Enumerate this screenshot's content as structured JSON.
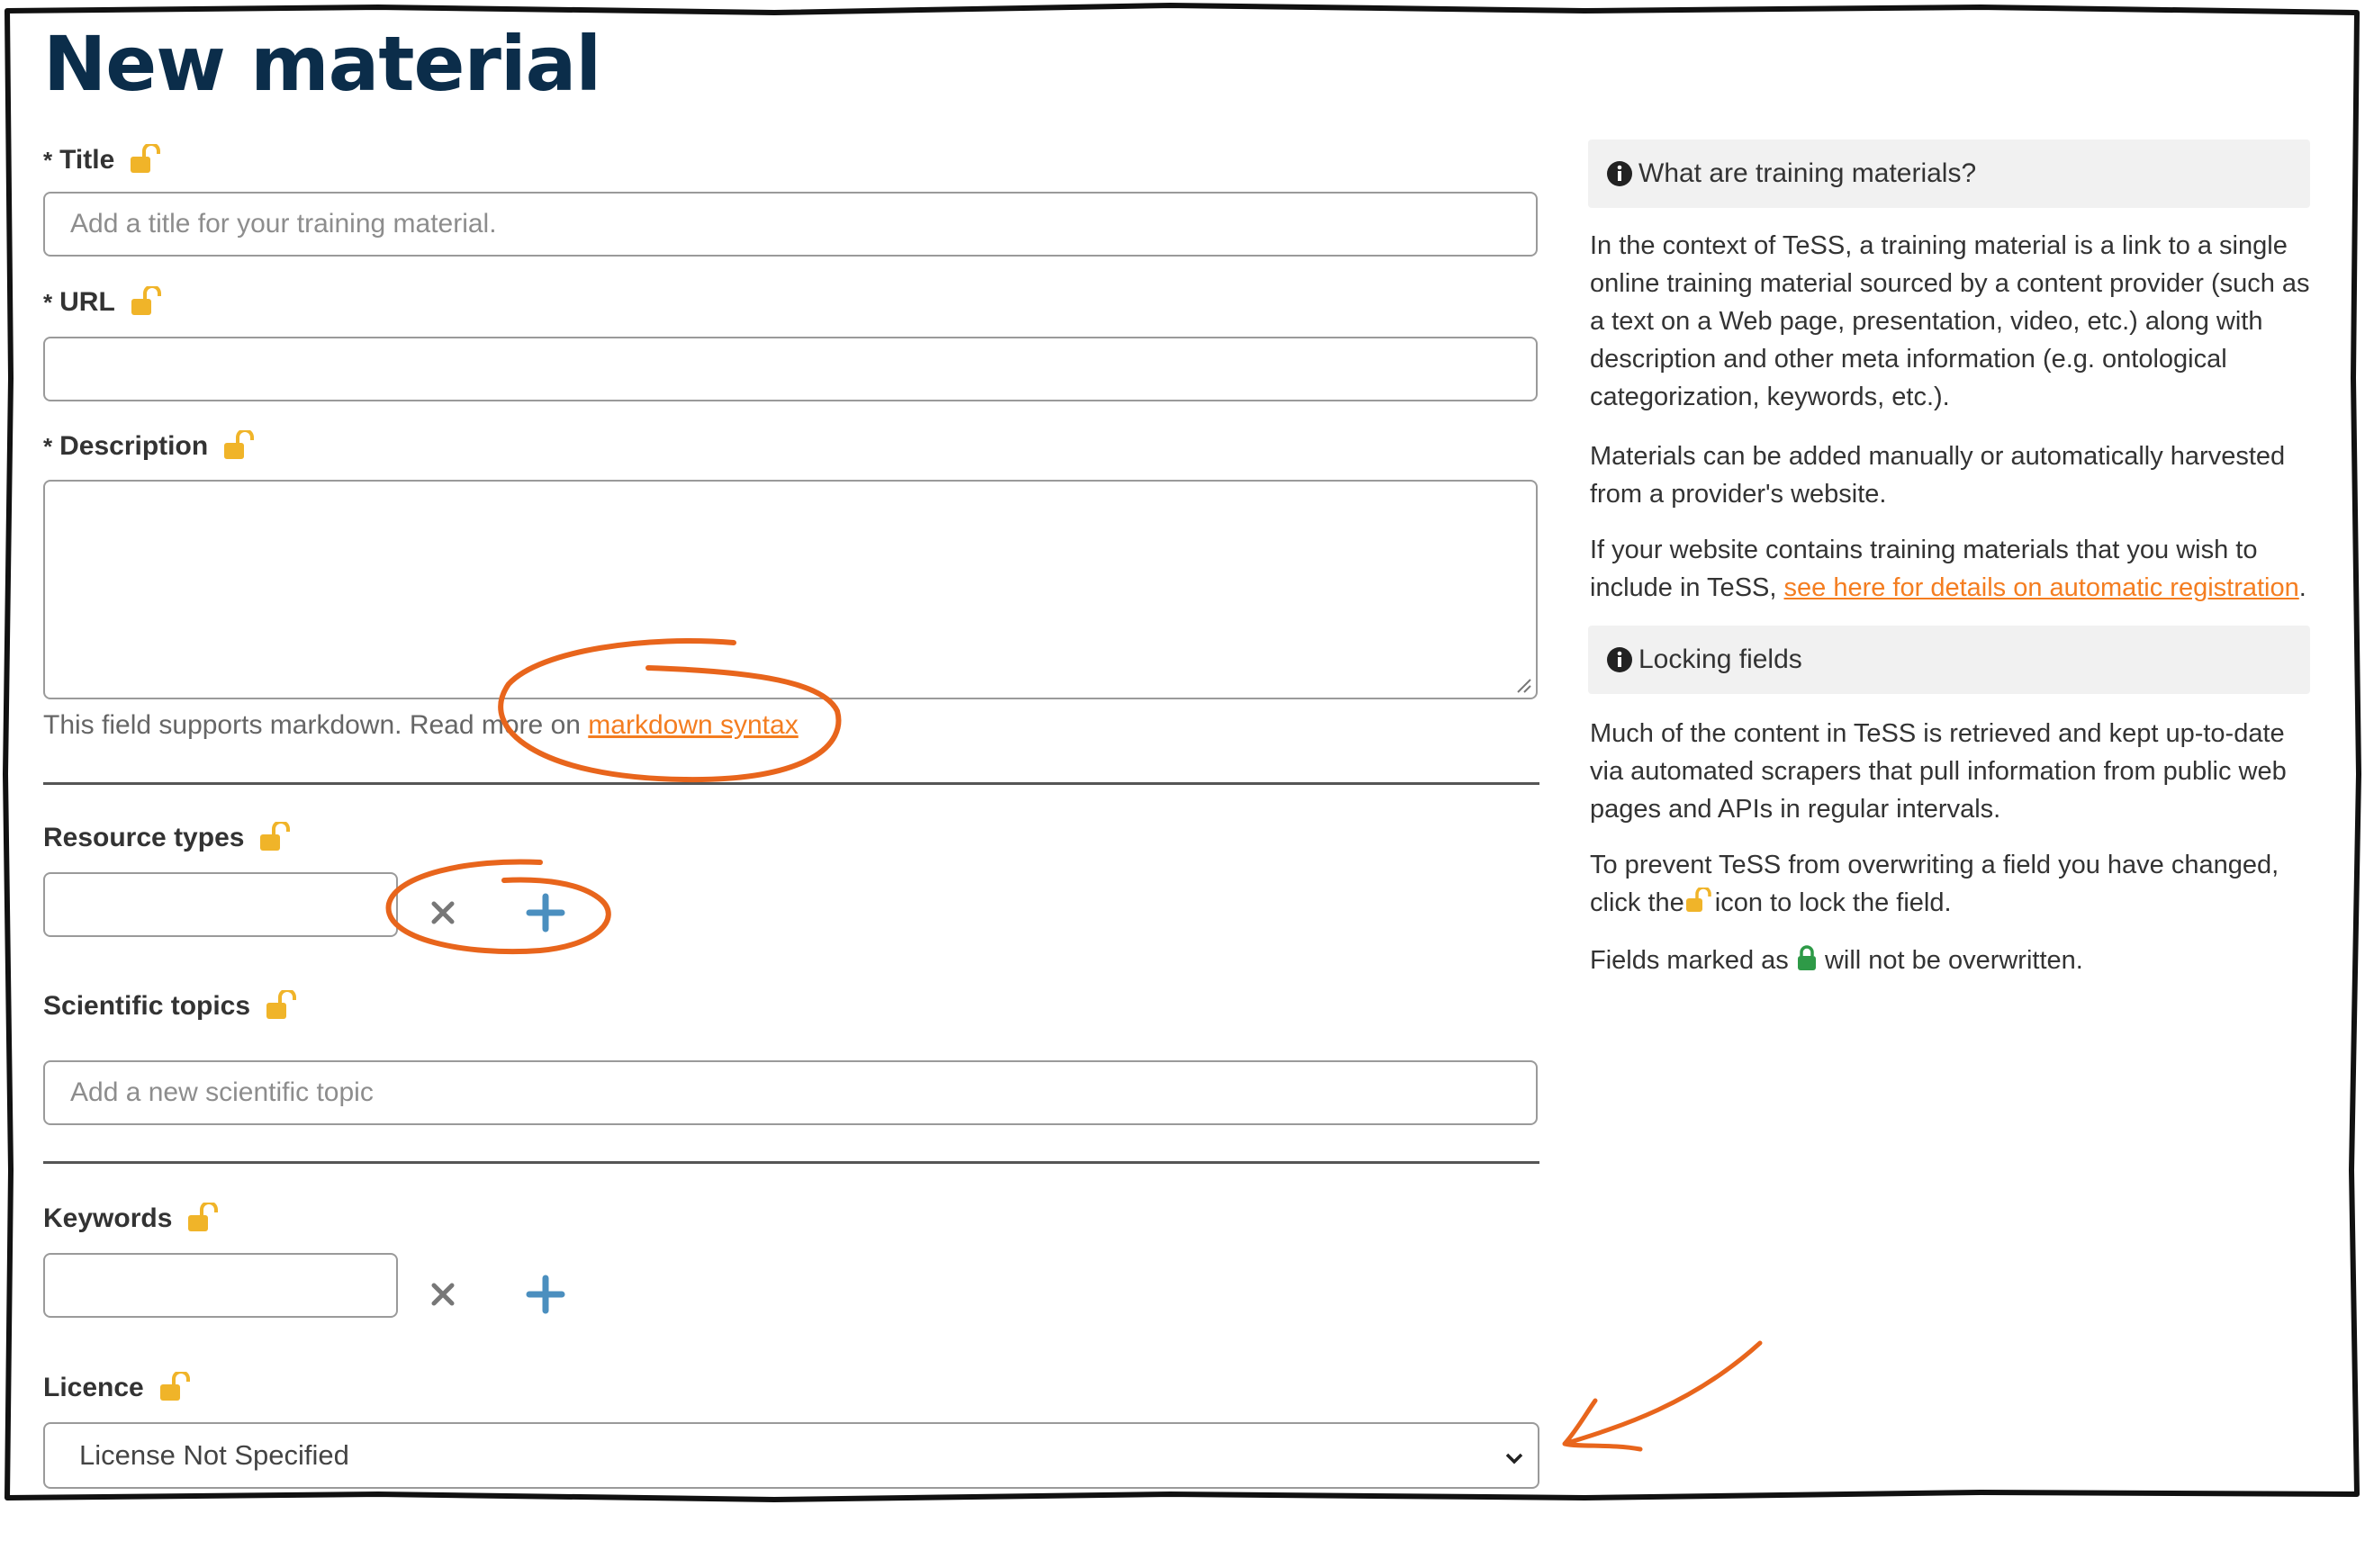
{
  "page": {
    "title": "New material"
  },
  "form": {
    "title": {
      "label": "Title",
      "required_mark": "*",
      "placeholder": "Add a title for your training material."
    },
    "url": {
      "label": "URL",
      "required_mark": "*",
      "value": ""
    },
    "description": {
      "label": "Description",
      "required_mark": "*",
      "help_prefix": "This field supports markdown. Read more on ",
      "help_link": "markdown syntax"
    },
    "resource_types": {
      "label": "Resource types"
    },
    "scientific_topics": {
      "label": "Scientific topics",
      "placeholder": "Add a new scientific topic"
    },
    "keywords": {
      "label": "Keywords"
    },
    "licence": {
      "label": "Licence",
      "selected": "License Not Specified"
    }
  },
  "sidebar": {
    "what_heading": "What are training materials?",
    "what_p1": "In the context of TeSS, a training material is a link to a single online training material sourced by a content provider (such as a text on a Web page, presentation, video, etc.) along with description and other meta information (e.g. ontological categorization, keywords, etc.).",
    "what_p2": "Materials can be added manually or automatically harvested from a provider's website.",
    "what_p3_prefix": "If your website contains training materials that you wish to include in TeSS, ",
    "what_p3_link": "see here for details on automatic registration",
    "what_p3_suffix": ".",
    "locking_heading": "Locking fields",
    "locking_p1": "Much of the content in TeSS is retrieved and kept up-to-date via automated scrapers that pull information from public web pages and APIs in regular intervals.",
    "locking_p2_prefix": "To prevent TeSS from overwriting a field you have changed, click the",
    "locking_p2_suffix": "icon to lock the field.",
    "locking_p3_prefix": "Fields marked as",
    "locking_p3_suffix": "will not be overwritten."
  },
  "colors": {
    "link": "#f47d20",
    "lock_open": "#f0b429",
    "lock_closed": "#2e9a47",
    "annotation": "#e8651c",
    "heading": "#0b2d4a"
  },
  "icons": {
    "lock_open": "unlocked-padlock-icon",
    "lock_closed": "locked-padlock-icon",
    "info": "info-circle-icon",
    "remove": "x-icon",
    "add": "plus-icon",
    "dropdown": "chevron-down-icon"
  }
}
